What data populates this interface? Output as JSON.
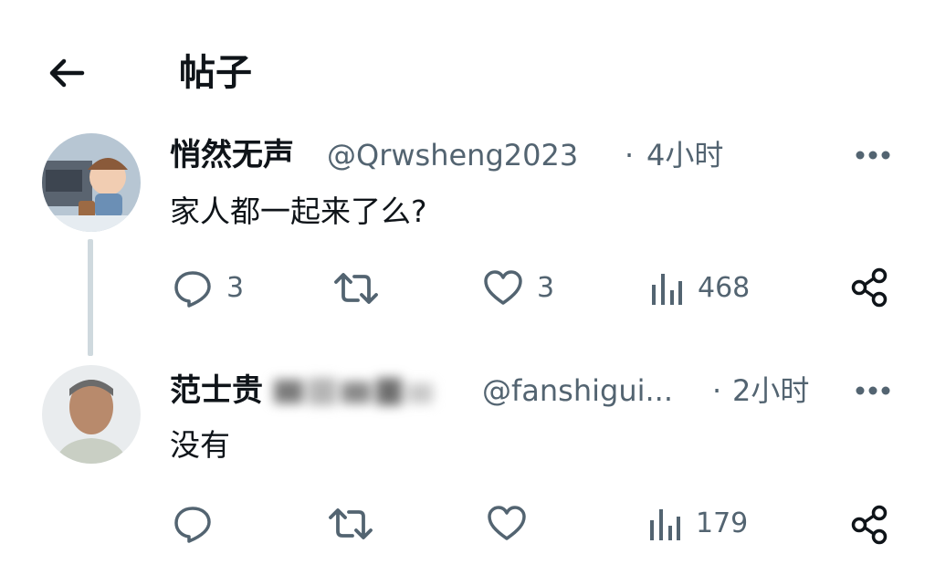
{
  "header": {
    "title": "帖子",
    "back_icon": "arrow-left-icon"
  },
  "posts": [
    {
      "display_name": "悄然无声",
      "handle": "@Qrwsheng2023",
      "separator": "·",
      "time": "4小时",
      "text": "家人都一起来了么?",
      "actions": {
        "replies": "3",
        "reposts": "",
        "likes": "3",
        "views": "468"
      }
    },
    {
      "display_name": "范士贵",
      "handle": "@fanshigui...",
      "separator": "·",
      "time": "2小时",
      "text": "没有",
      "actions": {
        "replies": "",
        "reposts": "",
        "likes": "",
        "views": "179"
      }
    }
  ],
  "colors": {
    "text": "#0f1419",
    "secondary": "#536471",
    "thread_line": "#cfd9de"
  }
}
